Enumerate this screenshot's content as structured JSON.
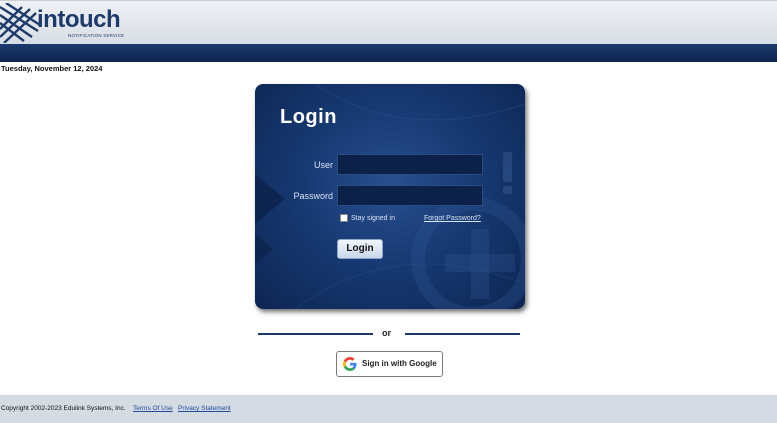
{
  "header": {
    "logo_text": "intouch",
    "logo_subtitle": "NOTIFICATION SERVICE"
  },
  "date": "Tuesday, November 12, 2024",
  "login": {
    "title": "Login",
    "user_label": "User",
    "user_value": "",
    "password_label": "Password",
    "password_value": "",
    "stay_signed_in_label": "Stay signed in",
    "stay_signed_in_checked": false,
    "forgot_password_label": "Forgot Password?",
    "submit_label": "Login"
  },
  "divider": {
    "text": "or"
  },
  "google": {
    "label": "Sign in with Google"
  },
  "footer": {
    "copyright": "Copyright 2002-2023 Edulink Systems, Inc.",
    "terms_label": "Terms Of Use",
    "privacy_label": "Privacy Statement"
  },
  "colors": {
    "brand_navy": "#1e3a6b",
    "panel_blue": "#173a73",
    "footer_bg": "#d4dbe3"
  }
}
